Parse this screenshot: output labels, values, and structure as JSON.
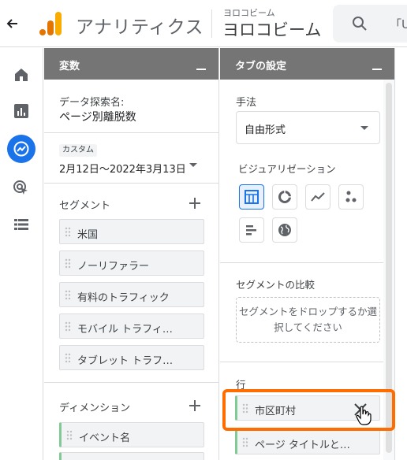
{
  "header": {
    "back_icon": "arrow-left-icon",
    "app_name": "アナリティクス",
    "account_small": "ヨロコビーム",
    "account_name": "ヨロコビーム",
    "search_placeholder": "「U"
  },
  "left_nav": {
    "items": [
      {
        "icon": "home-icon"
      },
      {
        "icon": "reports-icon"
      },
      {
        "icon": "explore-icon",
        "active": true
      },
      {
        "icon": "advertising-icon"
      },
      {
        "icon": "configure-icon"
      }
    ]
  },
  "variables_panel": {
    "title": "変数",
    "exploration_label": "データ探索名:",
    "exploration_name": "ページ別離脱数",
    "date_badge": "カスタム",
    "date_range": "2月12日～2022年3月13日",
    "segments_label": "セグメント",
    "segments": [
      "米国",
      "ノーリファラー",
      "有料のトラフィック",
      "モバイル トラフィ…",
      "タブレット トラフ…"
    ],
    "dimensions_label": "ディメンション",
    "dimensions": [
      "イベント名"
    ]
  },
  "tab_settings_panel": {
    "title": "タブの設定",
    "technique_label": "手法",
    "technique_value": "自由形式",
    "visualization_label": "ビジュアリゼーション",
    "visualizations": [
      "table-icon",
      "donut-chart-icon",
      "line-chart-icon",
      "scatter-plot-icon",
      "bar-chart-icon",
      "geo-map-icon"
    ],
    "segment_compare_label": "セグメントの比較",
    "segment_drop_text": "セグメントをドロップするか選択してください",
    "rows_label": "行",
    "rows": [
      "市区町村",
      "ページ タイトルと…"
    ]
  },
  "colors": {
    "accent": "#1a73e8",
    "highlight": "#ff6d00",
    "chip_green": "#81c995",
    "panel_header": "#757575"
  }
}
